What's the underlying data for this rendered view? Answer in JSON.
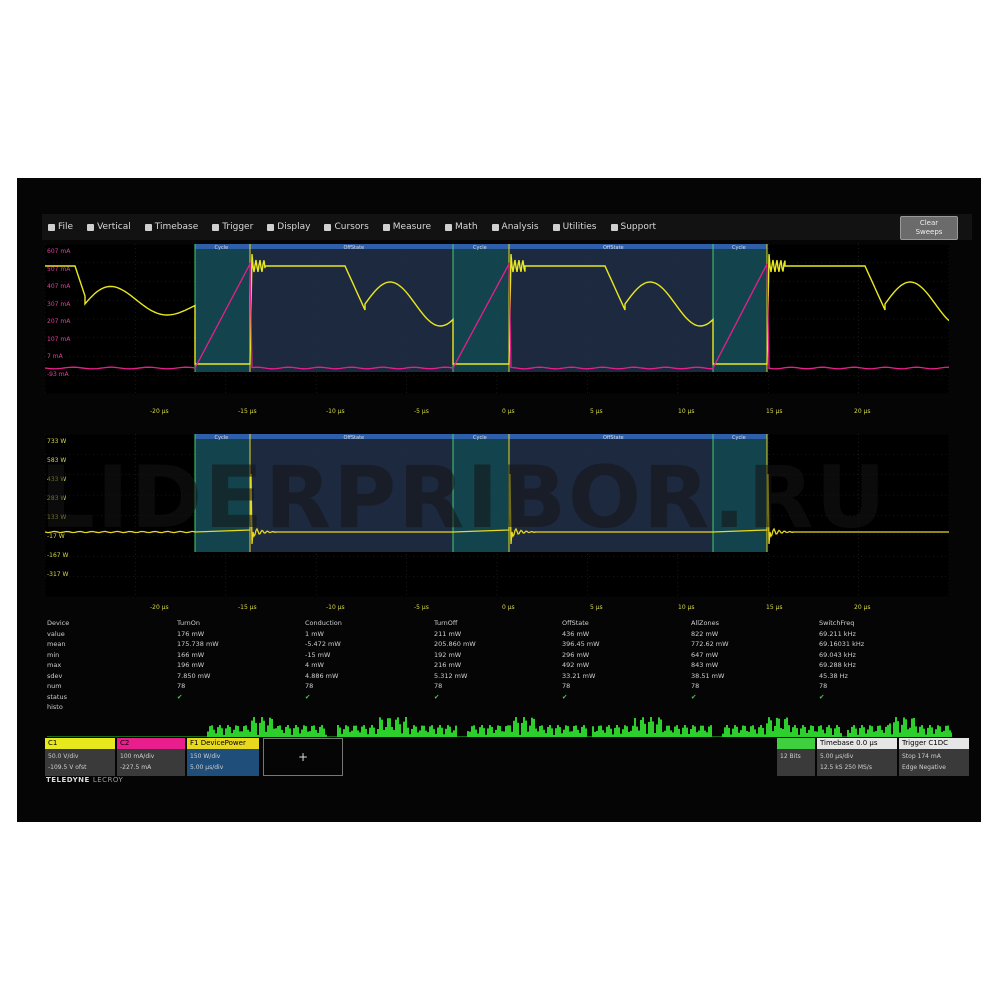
{
  "menu": {
    "items": [
      {
        "label": "File",
        "icon": "home-icon"
      },
      {
        "label": "Vertical",
        "icon": "vertical-icon"
      },
      {
        "label": "Timebase",
        "icon": "timebase-icon"
      },
      {
        "label": "Trigger",
        "icon": "trigger-icon"
      },
      {
        "label": "Display",
        "icon": "display-icon"
      },
      {
        "label": "Cursors",
        "icon": "cursor-icon"
      },
      {
        "label": "Measure",
        "icon": "measure-icon"
      },
      {
        "label": "Math",
        "icon": "math-icon"
      },
      {
        "label": "Analysis",
        "icon": "analysis-icon"
      },
      {
        "label": "Utilities",
        "icon": "utilities-icon"
      },
      {
        "label": "Support",
        "icon": "support-icon"
      }
    ],
    "clear_sweeps": "Clear\nSweeps"
  },
  "top_grid": {
    "y_labels": [
      "607 mA",
      "507 mA",
      "407 mA",
      "307 mA",
      "207 mA",
      "107 mA",
      "7 mA",
      "-93 mA"
    ],
    "x_labels": [
      "-20 µs",
      "-15 µs",
      "-10 µs",
      "-5 µs",
      "0 µs",
      "5 µs",
      "10 µs",
      "15 µs",
      "20 µs"
    ],
    "zone_labels": [
      "Cycle",
      "OffState",
      "Cycle",
      "OffState",
      "Cycle"
    ]
  },
  "bottom_grid": {
    "y_labels": [
      "733 W",
      "583 W",
      "433 W",
      "283 W",
      "133 W",
      "-17 W",
      "-167 W",
      "-317 W"
    ],
    "x_labels": [
      "-20 µs",
      "-15 µs",
      "-10 µs",
      "-5 µs",
      "0 µs",
      "5 µs",
      "10 µs",
      "15 µs",
      "20 µs"
    ],
    "zone_labels": [
      "Cycle",
      "OffState",
      "Cycle",
      "OffState",
      "Cycle"
    ]
  },
  "measurements": {
    "row_labels": [
      "Device",
      "value",
      "mean",
      "min",
      "max",
      "sdev",
      "num",
      "status",
      "histo"
    ],
    "columns": [
      {
        "title": "TurnOn",
        "values": [
          "176 mW",
          "175.738 mW",
          "166 mW",
          "196 mW",
          "7.850 mW",
          "78"
        ]
      },
      {
        "title": "Conduction",
        "values": [
          "1 mW",
          "-5.472 mW",
          "-15 mW",
          "4 mW",
          "4.886 mW",
          "78"
        ]
      },
      {
        "title": "TurnOff",
        "values": [
          "211 mW",
          "205.860 mW",
          "192 mW",
          "216 mW",
          "5.312 mW",
          "78"
        ]
      },
      {
        "title": "OffState",
        "values": [
          "436 mW",
          "396.45 mW",
          "296 mW",
          "492 mW",
          "33.21 mW",
          "78"
        ]
      },
      {
        "title": "AllZones",
        "values": [
          "822 mW",
          "772.62 mW",
          "647 mW",
          "843 mW",
          "38.51 mW",
          "78"
        ]
      },
      {
        "title": "SwitchFreq",
        "values": [
          "69.211 kHz",
          "69.16031 kHz",
          "69.043 kHz",
          "69.288 kHz",
          "45.38 Hz",
          "78"
        ]
      }
    ]
  },
  "channels": {
    "c1": {
      "name": "C1",
      "line1": "50.0 V/div",
      "line2": "-109.5 V ofst",
      "color": "#e8e81e"
    },
    "c2": {
      "name": "C2",
      "line1": "100 mA/div",
      "line2": "-227.5 mA",
      "color": "#e81e8c"
    },
    "f1": {
      "name": "F1",
      "title": "DevicePower",
      "line1": "150 W/div",
      "line2": "5.00 µs/div",
      "color": "#e8d81e"
    },
    "add": "+",
    "bits": {
      "label": "",
      "value": "12 Bits"
    },
    "timebase": {
      "title": "Timebase",
      "value_a": "0.0 µs",
      "line1": "5.00 µs/div",
      "line2": "12.5 kS  250 MS/s"
    },
    "trigger": {
      "title": "Trigger",
      "value_a": "C1DC",
      "line1": "Stop  174 mA",
      "line2": "Edge  Negative"
    }
  },
  "logo": {
    "brand": "TELEDYNE",
    "sub": "LECROY"
  },
  "watermark": "LIDERPRIBOR.RU"
}
